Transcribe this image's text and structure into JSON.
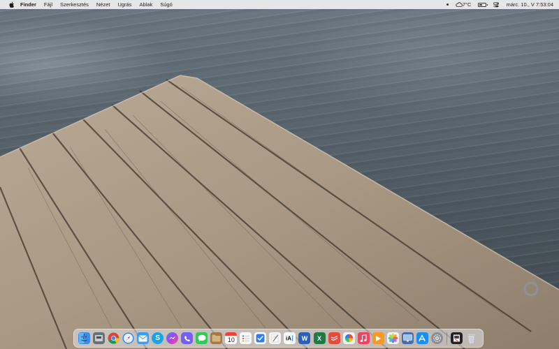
{
  "menubar": {
    "app_name": "Finder",
    "menus": [
      "Fájl",
      "Szerkesztés",
      "Nézet",
      "Ugrás",
      "Ablak",
      "Súgó"
    ],
    "weather": "7°C",
    "clock": "márc. 10., V  7:53:04",
    "battery_level": 0.45
  },
  "icons": {
    "apple": "apple-logo",
    "weather": "cloud-icon",
    "battery": "battery-icon",
    "control_center": "control-center-icon"
  },
  "dock": {
    "calendar_day": "10",
    "apps": [
      {
        "name": "finder",
        "color": "#3b8de8"
      },
      {
        "name": "disk-utility",
        "color": "#6b6f76"
      },
      {
        "name": "chrome",
        "color": "#f2f2f2"
      },
      {
        "name": "safari",
        "color": "#2e86e8"
      },
      {
        "name": "mail",
        "color": "#3b9cf0"
      },
      {
        "name": "skype",
        "color": "#1aa3e8"
      },
      {
        "name": "messenger",
        "color": "#8a4bf2"
      },
      {
        "name": "viber",
        "color": "#7360f2"
      },
      {
        "name": "messages",
        "color": "#36c759"
      },
      {
        "name": "notes-folder",
        "color": "#a27a45"
      },
      {
        "name": "calendar",
        "color": "#ffffff"
      },
      {
        "name": "reminders",
        "color": "#f7f7f7"
      },
      {
        "name": "things",
        "color": "#ffffff"
      },
      {
        "name": "textedit",
        "color": "#f4f4f4"
      },
      {
        "name": "ia-writer",
        "color": "#f7f7f7"
      },
      {
        "name": "word",
        "color": "#2b5fb8"
      },
      {
        "name": "excel",
        "color": "#1f7a45"
      },
      {
        "name": "todoist",
        "color": "#e64c3c"
      },
      {
        "name": "pinwheel",
        "color": "#f0f0f0"
      },
      {
        "name": "music",
        "color": "#f3425f"
      },
      {
        "name": "infuse",
        "color": "#f79a21"
      },
      {
        "name": "photos",
        "color": "#f4f4f4"
      },
      {
        "name": "screen-preview",
        "color": "#4a6fa8"
      },
      {
        "name": "app-store",
        "color": "#1c8ef0"
      },
      {
        "name": "system-preferences",
        "color": "#8a8d92"
      },
      {
        "name": "downloads-stack",
        "color": "#222222"
      },
      {
        "name": "trash",
        "color": "#d9dde2"
      }
    ]
  }
}
